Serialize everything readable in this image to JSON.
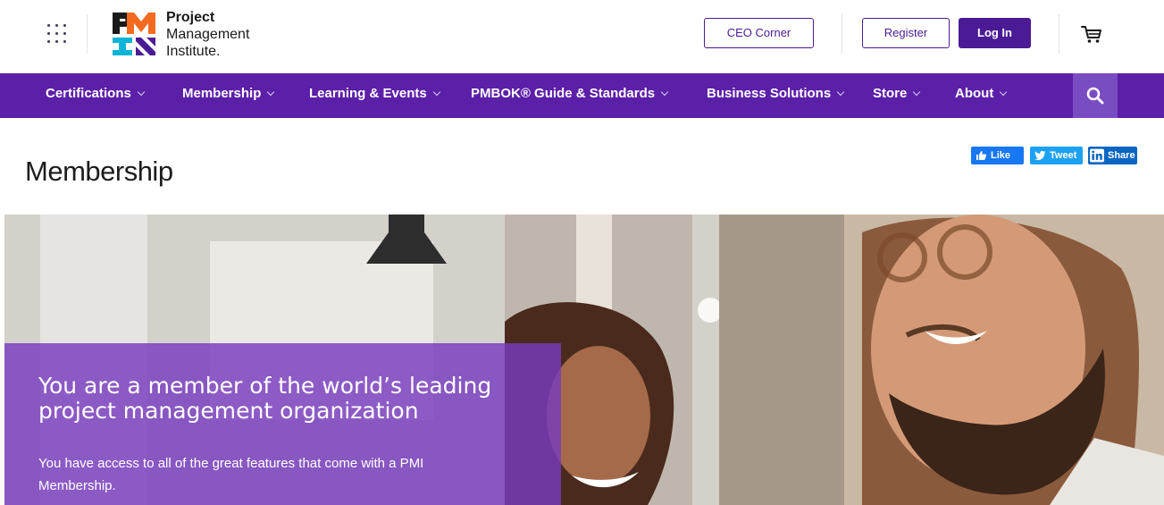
{
  "brand": {
    "line1": "Project",
    "line2": "Management",
    "line3": "Institute."
  },
  "header": {
    "ceo_label": "CEO Corner",
    "register_label": "Register",
    "login_label": "Log In"
  },
  "nav": {
    "items": [
      {
        "label": "Certifications"
      },
      {
        "label": "Membership"
      },
      {
        "label": "Learning & Events"
      },
      {
        "label": "PMBOK® Guide & Standards"
      },
      {
        "label": "Business Solutions"
      },
      {
        "label": "Store"
      },
      {
        "label": "About"
      }
    ]
  },
  "page": {
    "title": "Membership"
  },
  "social": {
    "like": "Like",
    "tweet": "Tweet",
    "share": "Share"
  },
  "hero": {
    "heading": "You are a member of the world’s leading project management organization",
    "text": "You have access to all of the great features that come with a PMI Membership."
  },
  "colors": {
    "brand_purple": "#4a1b94",
    "nav_purple": "#5c1fa8",
    "facebook": "#1877f2",
    "twitter": "#1da1f2",
    "linkedin": "#0a66c2"
  }
}
